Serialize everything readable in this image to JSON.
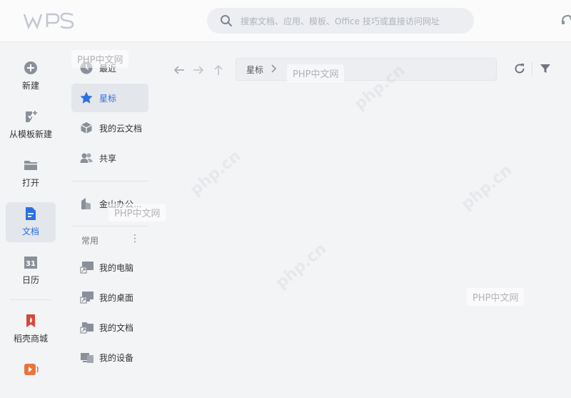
{
  "app": {
    "logo_text": "WPS",
    "search_placeholder": "搜索文档、应用、模板、Office 技巧或直接访问网址"
  },
  "rail": {
    "items": [
      {
        "label": "新建",
        "icon": "plus-circle-icon"
      },
      {
        "label": "从模板新建",
        "icon": "template-icon"
      },
      {
        "label": "打开",
        "icon": "folder-icon"
      },
      {
        "label": "文档",
        "icon": "document-icon",
        "active": true
      },
      {
        "label": "日历",
        "icon": "calendar-icon"
      },
      {
        "label": "稻壳商城",
        "icon": "docer-shop-icon"
      }
    ]
  },
  "nav": {
    "items": [
      {
        "label": "最近",
        "icon": "clock-icon"
      },
      {
        "label": "星标",
        "icon": "star-icon",
        "active": true
      },
      {
        "label": "我的云文档",
        "icon": "cloud-box-icon"
      },
      {
        "label": "共享",
        "icon": "share-users-icon"
      },
      {
        "label": "金山办公...",
        "icon": "building-icon"
      }
    ],
    "section_title": "常用",
    "section_more": "⋮",
    "favorites": [
      {
        "label": "我的电脑",
        "icon": "computer-shortcut-icon"
      },
      {
        "label": "我的桌面",
        "icon": "desktop-shortcut-icon"
      },
      {
        "label": "我的文档",
        "icon": "documents-folder-icon"
      },
      {
        "label": "我的设备",
        "icon": "devices-icon"
      }
    ]
  },
  "main": {
    "breadcrumb": "星标",
    "breadcrumb_sep": "chevron-right-icon"
  },
  "watermarks": {
    "box_text": "PHP中文网",
    "diag_text": "php.cn"
  },
  "colors": {
    "accent": "#2e6fe0",
    "icon_gray": "#8a909a",
    "docer_red": "#d9473a",
    "docer_orange": "#e8763c"
  }
}
